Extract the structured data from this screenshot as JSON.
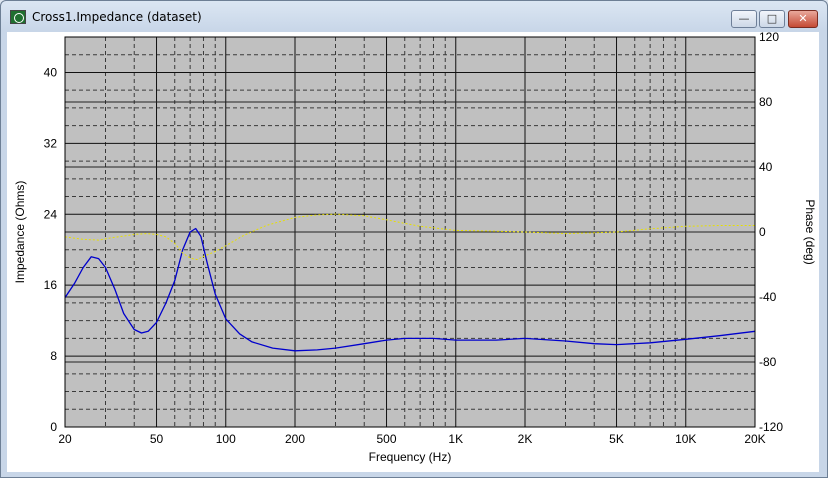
{
  "window": {
    "title": "Cross1.Impedance (dataset)",
    "buttons": {
      "minimize": "—",
      "maximize": "□",
      "close": "✕"
    }
  },
  "chart_data": {
    "type": "line",
    "title": "",
    "xlabel": "Frequency (Hz)",
    "ylabel": "Impedance (Ohms)",
    "y2label": "Phase (deg)",
    "x_scale": "log",
    "xlim": [
      20,
      20000
    ],
    "ylim": [
      0,
      44
    ],
    "y2lim": [
      -120,
      120
    ],
    "x_ticks": [
      {
        "value": 20,
        "label": "20"
      },
      {
        "value": 50,
        "label": "50"
      },
      {
        "value": 100,
        "label": "100"
      },
      {
        "value": 200,
        "label": "200"
      },
      {
        "value": 500,
        "label": "500"
      },
      {
        "value": 1000,
        "label": "1K"
      },
      {
        "value": 2000,
        "label": "2K"
      },
      {
        "value": 5000,
        "label": "5K"
      },
      {
        "value": 10000,
        "label": "10K"
      },
      {
        "value": 20000,
        "label": "20K"
      }
    ],
    "y_ticks": [
      0,
      8,
      16,
      24,
      32,
      40
    ],
    "y2_ticks": [
      -120,
      -80,
      -40,
      0,
      40,
      80,
      120
    ],
    "grid": true,
    "colors": {
      "plot_bg": "#c0c0c0",
      "impedance": "#0000cc",
      "phase": "#e8e000"
    },
    "series": [
      {
        "axis": "left",
        "style": "solid",
        "points": [
          [
            20,
            14.6
          ],
          [
            22,
            16.2
          ],
          [
            24,
            18.0
          ],
          [
            26,
            19.2
          ],
          [
            28,
            19.0
          ],
          [
            30,
            18.0
          ],
          [
            33,
            15.5
          ],
          [
            36,
            12.8
          ],
          [
            40,
            11.0
          ],
          [
            43,
            10.6
          ],
          [
            46,
            10.8
          ],
          [
            50,
            11.8
          ],
          [
            55,
            14.0
          ],
          [
            60,
            16.5
          ],
          [
            65,
            20.0
          ],
          [
            70,
            22.0
          ],
          [
            74,
            22.4
          ],
          [
            78,
            21.5
          ],
          [
            83,
            18.5
          ],
          [
            90,
            15.0
          ],
          [
            100,
            12.2
          ],
          [
            115,
            10.5
          ],
          [
            130,
            9.6
          ],
          [
            160,
            8.9
          ],
          [
            200,
            8.6
          ],
          [
            250,
            8.7
          ],
          [
            300,
            8.9
          ],
          [
            400,
            9.4
          ],
          [
            500,
            9.8
          ],
          [
            600,
            10.0
          ],
          [
            800,
            10.0
          ],
          [
            1000,
            9.8
          ],
          [
            1500,
            9.8
          ],
          [
            2000,
            10.0
          ],
          [
            3000,
            9.7
          ],
          [
            4000,
            9.4
          ],
          [
            5000,
            9.3
          ],
          [
            7000,
            9.5
          ],
          [
            10000,
            9.9
          ],
          [
            14000,
            10.3
          ],
          [
            20000,
            10.8
          ]
        ]
      },
      {
        "axis": "right",
        "style": "dotted",
        "points": [
          [
            20,
            -3
          ],
          [
            24,
            -4.5
          ],
          [
            28,
            -5
          ],
          [
            32,
            -3.5
          ],
          [
            36,
            -2.5
          ],
          [
            40,
            -1.5
          ],
          [
            45,
            -1
          ],
          [
            50,
            -1.5
          ],
          [
            55,
            -3
          ],
          [
            60,
            -7
          ],
          [
            65,
            -13
          ],
          [
            70,
            -16
          ],
          [
            75,
            -17
          ],
          [
            80,
            -15
          ],
          [
            90,
            -12
          ],
          [
            100,
            -8.5
          ],
          [
            120,
            -2
          ],
          [
            150,
            4
          ],
          [
            200,
            9
          ],
          [
            250,
            10.5
          ],
          [
            300,
            11
          ],
          [
            400,
            10
          ],
          [
            500,
            7.5
          ],
          [
            700,
            3.5
          ],
          [
            1000,
            1
          ],
          [
            1500,
            0.5
          ],
          [
            2000,
            0
          ],
          [
            3000,
            -1
          ],
          [
            4000,
            -0.5
          ],
          [
            5000,
            0
          ],
          [
            7000,
            2
          ],
          [
            10000,
            3.5
          ],
          [
            14000,
            4
          ],
          [
            20000,
            4
          ]
        ]
      }
    ]
  }
}
